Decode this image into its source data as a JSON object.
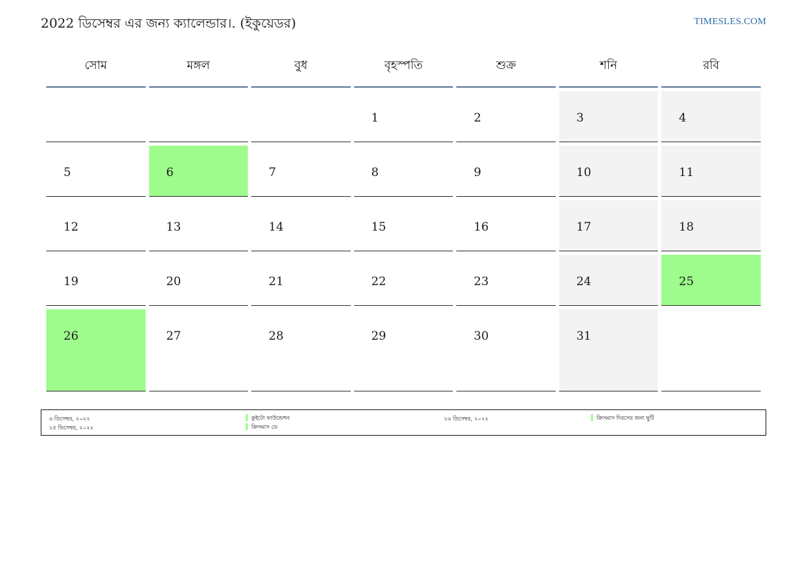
{
  "header": {
    "title": "2022 ডিসেম্বর এর জন্য ক্যালেন্ডার।. (ইকুয়েডর)",
    "site": "TIMESLES.COM"
  },
  "weekdays": [
    "সোম",
    "মঙ্গল",
    "বুধ",
    "বৃহস্পতি",
    "শুক্র",
    "শনি",
    "রবি"
  ],
  "weeks": [
    [
      "",
      "",
      "",
      "1",
      "2",
      "3",
      "4"
    ],
    [
      "5",
      "6",
      "7",
      "8",
      "9",
      "10",
      "11"
    ],
    [
      "12",
      "13",
      "14",
      "15",
      "16",
      "17",
      "18"
    ],
    [
      "19",
      "20",
      "21",
      "22",
      "23",
      "24",
      "25"
    ],
    [
      "26",
      "27",
      "28",
      "29",
      "30",
      "31",
      ""
    ]
  ],
  "holidays": [
    {
      "date": "৬ ডিসেম্বর, ২০২২",
      "name": "কুইটো ফাউন্ডেশন"
    },
    {
      "date": "২৫ ডিসেম্বর, ২০২২",
      "name": "ক্রিসমাস ডে"
    },
    {
      "date": "২৬ ডিসেম্বর, ২০২২",
      "name": "ক্রিসমাস দিবসের জন্য ছুটি"
    }
  ],
  "colors": {
    "holiday": "#9dfc8c",
    "weekend": "#f3f3f3",
    "header_rule": "#5d7899",
    "link": "#2f6ea8"
  }
}
